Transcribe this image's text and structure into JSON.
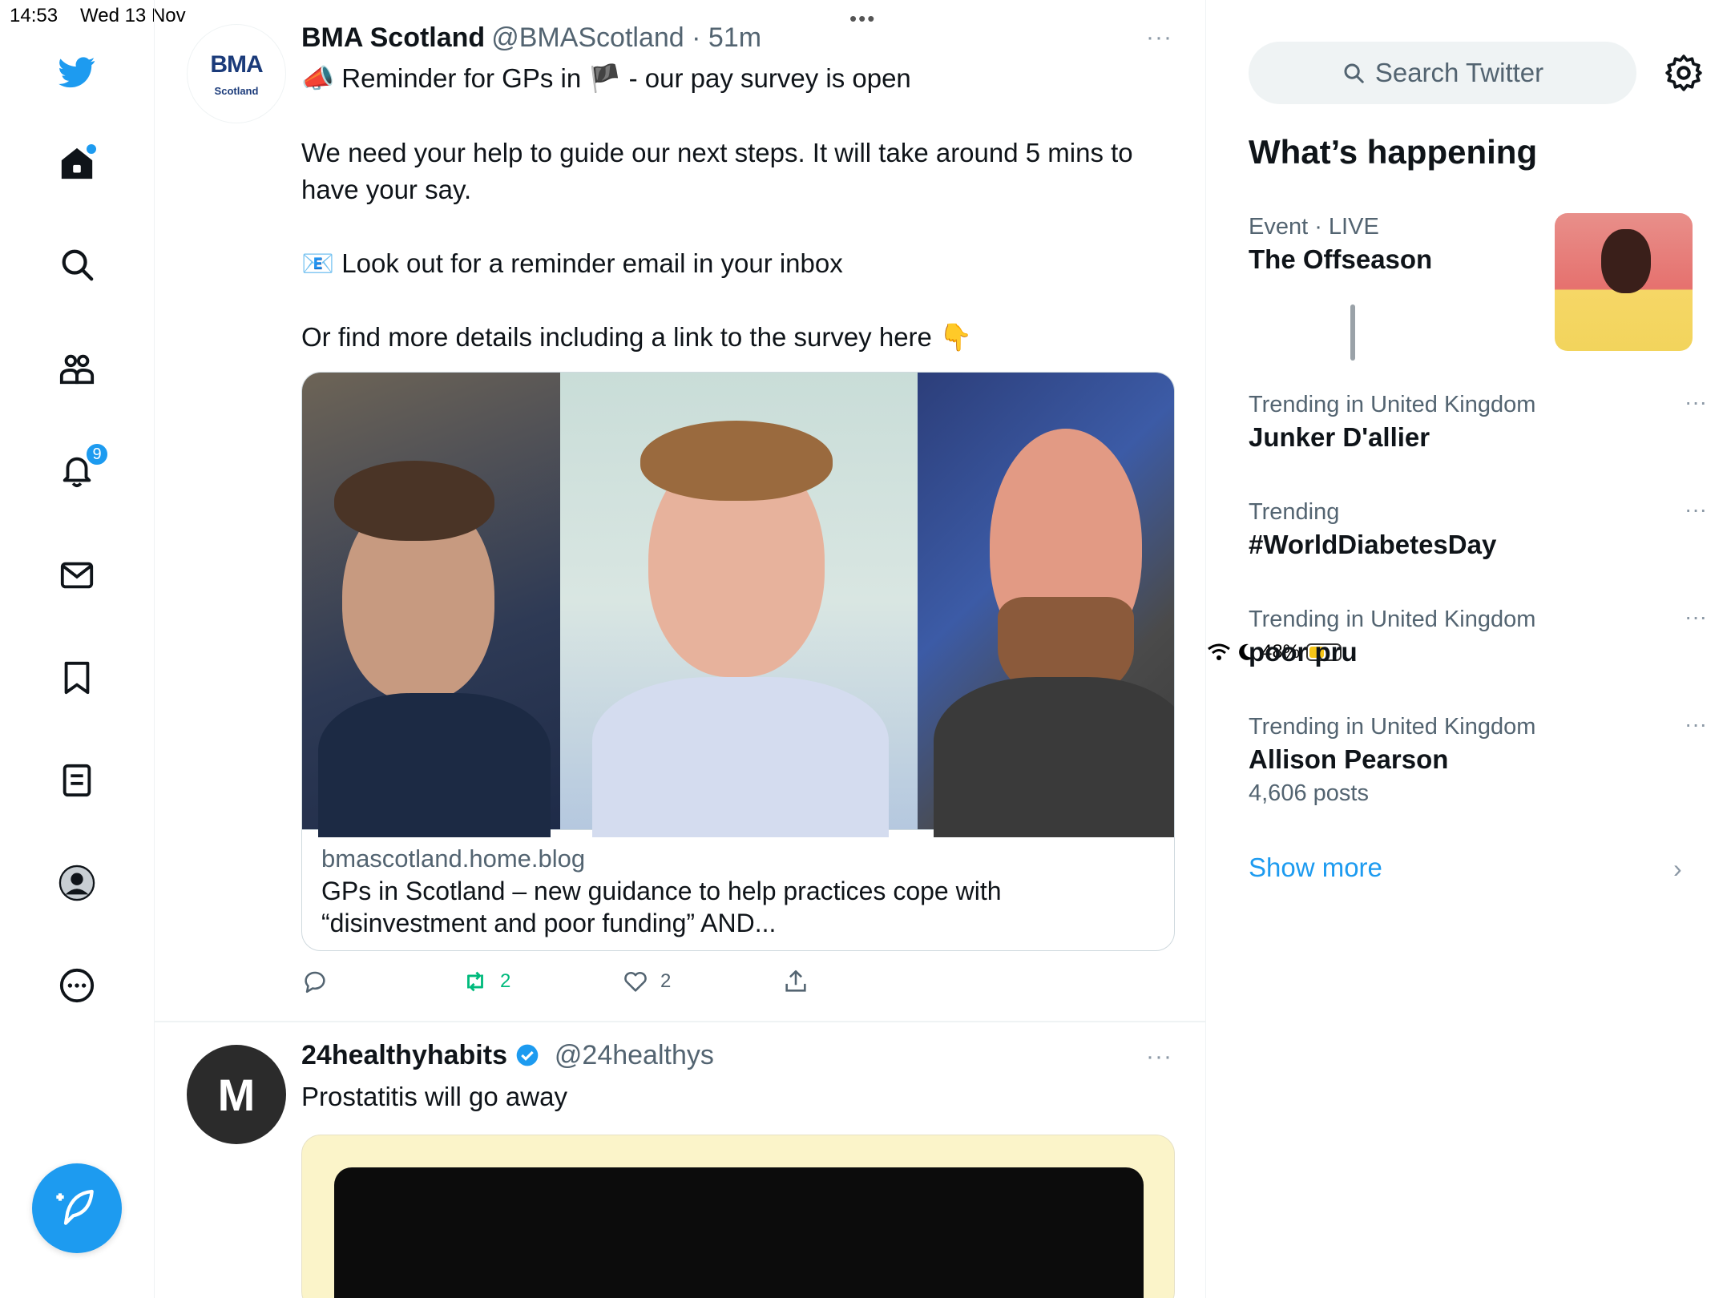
{
  "status_bar": {
    "time": "14:53",
    "date": "Wed 13 Nov",
    "battery": "48%",
    "multitask": "•••"
  },
  "nav": {
    "notifications_badge": "9",
    "accent_color": "#1d9bf0"
  },
  "tweets": [
    {
      "avatar_logo": "BMA",
      "avatar_sub": "Scotland",
      "name": "BMA Scotland",
      "handle": "@BMAScotland · 51m",
      "more": "···",
      "line1": "📣 Reminder for GPs in 🏴 - our pay survey is open",
      "line2": "We need your help to guide our next steps. It will take around 5 mins to have your say.",
      "line3": "📧 Look out for a reminder email in your inbox",
      "line4": "Or find more details including a link to the survey here 👇",
      "card_domain": "bmascotland.home.blog",
      "card_title": "GPs in Scotland – new guidance to help practices cope with “disinvestment and poor funding” AND...",
      "retweets": "2",
      "likes": "2"
    },
    {
      "avatar_text": "M",
      "name": "24healthyhabits",
      "handle": "@24healthys",
      "more": "···",
      "text": "Prostatitis will go away"
    }
  ],
  "sidebar": {
    "search_placeholder": "Search Twitter",
    "title": "What’s happening",
    "event": {
      "context": "Event · LIVE",
      "title": "The Offseason"
    },
    "trends": [
      {
        "context": "Trending in United Kingdom",
        "title": "Junker D'allier",
        "count": ""
      },
      {
        "context": "Trending",
        "title": "#WorldDiabetesDay",
        "count": ""
      },
      {
        "context": "Trending in United Kingdom",
        "title": "poor pru",
        "count": ""
      },
      {
        "context": "Trending in United Kingdom",
        "title": "Allison Pearson",
        "count": "4,606 posts"
      }
    ],
    "more_dots": "···",
    "show_more": "Show more",
    "chevron": "›"
  }
}
